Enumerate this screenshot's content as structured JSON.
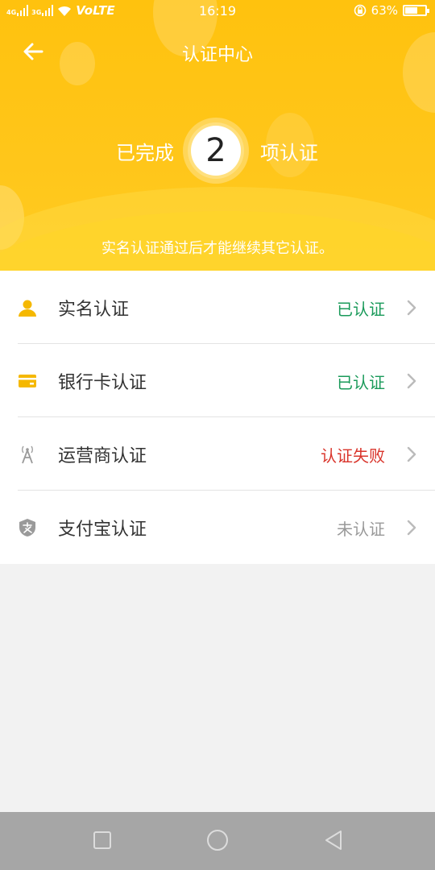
{
  "status_bar": {
    "left_text": "VoLTE",
    "signal_1_label": "4G",
    "signal_2_label": "3G",
    "time": "16:19",
    "battery": "63%",
    "battery_level": 0.63
  },
  "header": {
    "title": "认证中心",
    "completed_prefix": "已完成",
    "completed_count": "2",
    "completed_suffix": "项认证",
    "hint": "实名认证通过后才能继续其它认证。"
  },
  "items": [
    {
      "label": "实名认证",
      "status": "已认证",
      "status_color": "#1a9a5a",
      "icon": "person-icon"
    },
    {
      "label": "银行卡认证",
      "status": "已认证",
      "status_color": "#1a9a5a",
      "icon": "bank-card-icon"
    },
    {
      "label": "运营商认证",
      "status": "认证失败",
      "status_color": "#d9342b",
      "icon": "signal-tower-icon"
    },
    {
      "label": "支付宝认证",
      "status": "未认证",
      "status_color": "#999999",
      "icon": "alipay-shield-icon"
    }
  ],
  "colors": {
    "header_yellow": "#ffc20e",
    "icon_yellow": "#f5b800",
    "icon_gray": "#9a9a9a"
  }
}
